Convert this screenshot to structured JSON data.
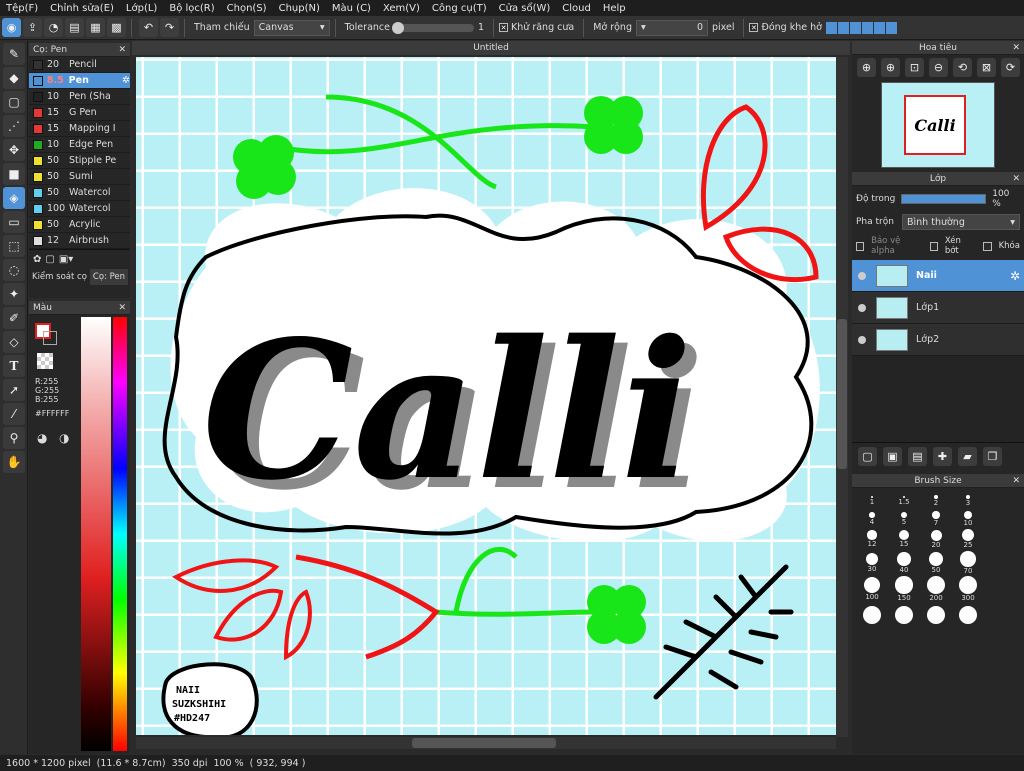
{
  "menu": [
    "Tệp(F)",
    "Chỉnh sửa(E)",
    "Lớp(L)",
    "Bộ lọc(R)",
    "Chọn(S)",
    "Chụp(N)",
    "Màu (C)",
    "Xem(V)",
    "Công cụ(T)",
    "Cửa sổ(W)",
    "Cloud",
    "Help"
  ],
  "toolbar": {
    "reference_label": "Tham chiếu",
    "reference_value": "Canvas",
    "tolerance_label": "Tolerance",
    "tolerance_value": "1",
    "antialias_label": "Khử răng cưa",
    "expand_label": "Mở rộng",
    "expand_value": "0",
    "expand_unit": "pixel",
    "close_gap_label": "Đóng khe hở"
  },
  "brush_panel": {
    "title": "Cọ: Pen",
    "items": [
      {
        "size": "20",
        "name": "Pencil",
        "color": "#333333"
      },
      {
        "size": "8.5",
        "name": "Pen",
        "color": "#4f93d6"
      },
      {
        "size": "10",
        "name": "Pen (Sha",
        "color": "#222222"
      },
      {
        "size": "15",
        "name": "G Pen",
        "color": "#e53935"
      },
      {
        "size": "15",
        "name": "Mapping I",
        "color": "#e53935"
      },
      {
        "size": "10",
        "name": "Edge Pen",
        "color": "#22aa22"
      },
      {
        "size": "50",
        "name": "Stipple Pe",
        "color": "#f0e030"
      },
      {
        "size": "50",
        "name": "Sumi",
        "color": "#f0e030"
      },
      {
        "size": "50",
        "name": "Watercol",
        "color": "#60d0f0"
      },
      {
        "size": "100",
        "name": "Watercol",
        "color": "#60d0f0"
      },
      {
        "size": "50",
        "name": "Acrylic",
        "color": "#f0e030"
      },
      {
        "size": "12",
        "name": "Airbrush",
        "color": "#dddddd"
      }
    ],
    "tab1": "Kiểm soát cọ",
    "tab2": "Cọ: Pen"
  },
  "color_panel": {
    "title": "Màu",
    "r": "R:255",
    "g": "G:255",
    "b": "B:255",
    "hex": "#FFFFFF"
  },
  "canvas": {
    "title": "Untitled"
  },
  "navigator": {
    "title": "Hoa tiêu"
  },
  "layers": {
    "title": "Lớp",
    "opacity_label": "Độ trong",
    "opacity_value": "100 %",
    "blend_label": "Pha trộn",
    "blend_value": "Bình thường",
    "protect_alpha": "Bảo vệ alpha",
    "clip": "Xén bớt",
    "lock": "Khóa",
    "items": [
      {
        "name": "Naii"
      },
      {
        "name": "Lớp1"
      },
      {
        "name": "Lớp2"
      }
    ]
  },
  "brush_size": {
    "title": "Brush Size",
    "sizes": [
      "1",
      "1.5",
      "2",
      "3",
      "4",
      "5",
      "7",
      "10",
      "12",
      "15",
      "20",
      "25",
      "30",
      "40",
      "50",
      "70",
      "100",
      "150",
      "200",
      "300",
      "",
      "",
      "",
      ""
    ]
  },
  "artwork": {
    "title_text": "Calli",
    "sig1": "NAII",
    "sig2": "SUZKSHIHI",
    "sig3": "#HD247",
    "colors": {
      "bg": "#b8f0f5",
      "grid": "#ffffff",
      "ink": "#000000",
      "green": "#19e619",
      "red": "#f01414"
    }
  },
  "status": {
    "size": "1600 * 1200 pixel",
    "cm": "(11.6 * 8.7cm)",
    "dpi": "350 dpi",
    "zoom": "100 %",
    "coords": "( 932, 994 )"
  }
}
